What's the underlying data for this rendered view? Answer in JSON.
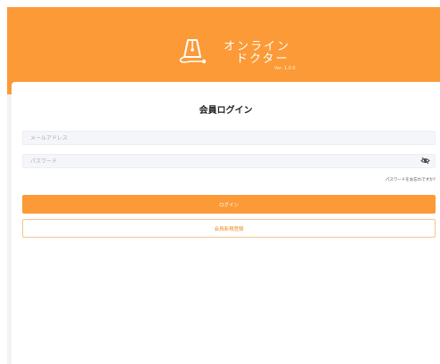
{
  "colors": {
    "accent": "#fb9a37",
    "background": "#ffffff",
    "field": "#f5f6fa"
  },
  "header": {
    "logo_icon": "metronome-stethoscope-icon",
    "brand_line1": "オンライン",
    "brand_line2": "ドクター",
    "version": "Ver. 1.0.0"
  },
  "login": {
    "title": "会員ログイン",
    "email_placeholder": "メールアドレス",
    "password_placeholder": "パスワード",
    "password_toggle_icon": "eye-slash-icon",
    "forgot_password": "パスワードをお忘れですか?",
    "submit_label": "ログイン",
    "register_label": "会員新規登録"
  }
}
